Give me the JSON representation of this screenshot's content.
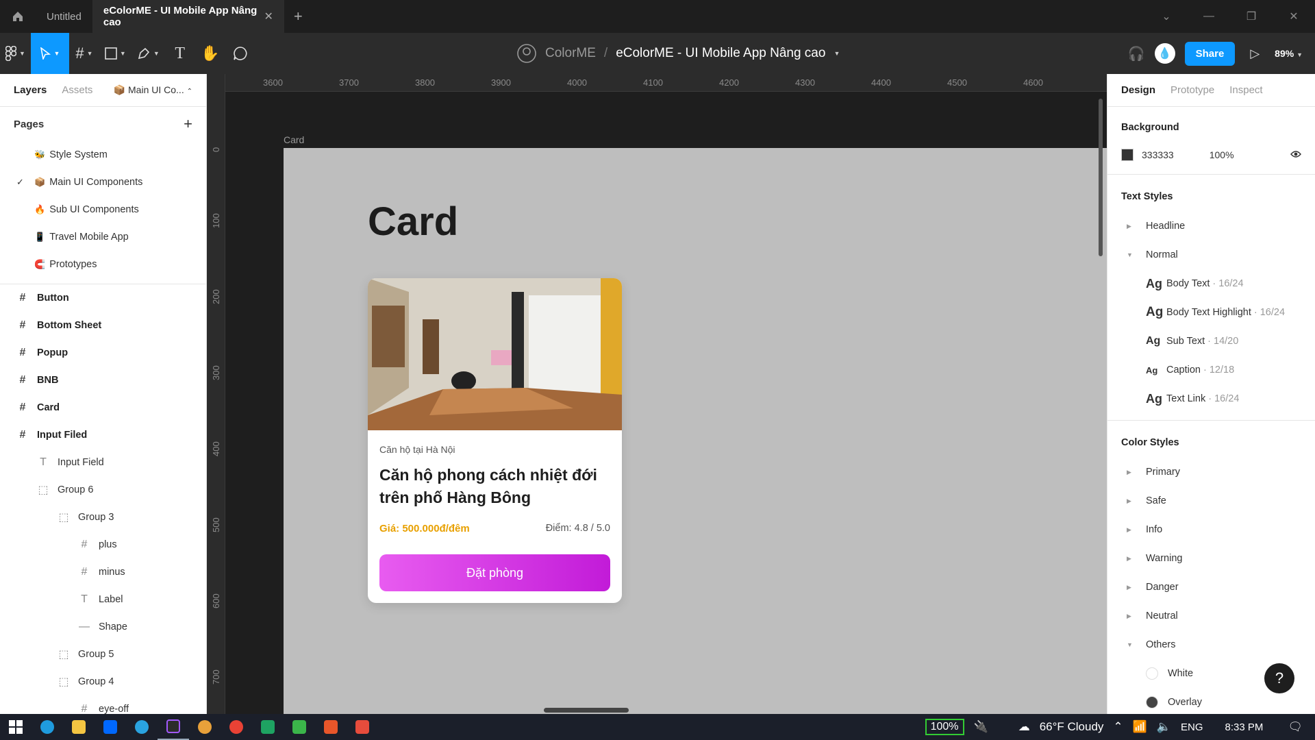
{
  "titlebar": {
    "tabs": [
      {
        "label": "Untitled"
      },
      {
        "label": "eColorME - UI Mobile App Nâng cao"
      }
    ]
  },
  "toolbar": {
    "team": "ColorME",
    "separator": "/",
    "file_name": "eColorME - UI Mobile App Nâng cao",
    "share_label": "Share",
    "zoom": "89%"
  },
  "left_panel": {
    "tabs": {
      "layers": "Layers",
      "assets": "Assets",
      "page": "Main UI Co..."
    },
    "pages_title": "Pages",
    "pages": [
      {
        "emoji": "🐝",
        "label": "Style System",
        "current": false
      },
      {
        "emoji": "📦",
        "label": "Main UI Components",
        "current": true
      },
      {
        "emoji": "🔥",
        "label": "Sub UI Components",
        "current": false
      },
      {
        "emoji": "📱",
        "label": "Travel Mobile App",
        "current": false
      },
      {
        "emoji": "🧲",
        "label": "Prototypes",
        "current": false
      }
    ],
    "layers": [
      {
        "icon": "#",
        "label": "Button",
        "indent": 0,
        "frame": true
      },
      {
        "icon": "#",
        "label": "Bottom Sheet",
        "indent": 0,
        "frame": true
      },
      {
        "icon": "#",
        "label": "Popup",
        "indent": 0,
        "frame": true
      },
      {
        "icon": "#",
        "label": "BNB",
        "indent": 0,
        "frame": true
      },
      {
        "icon": "#",
        "label": "Card",
        "indent": 0,
        "frame": true
      },
      {
        "icon": "#",
        "label": "Input Filed",
        "indent": 0,
        "frame": true
      },
      {
        "icon": "T",
        "label": "Input Field",
        "indent": 1,
        "frame": false
      },
      {
        "icon": "⬚",
        "label": "Group 6",
        "indent": 1,
        "frame": false
      },
      {
        "icon": "⬚",
        "label": "Group 3",
        "indent": 2,
        "frame": false
      },
      {
        "icon": "#",
        "label": "plus",
        "indent": 3,
        "frame": false
      },
      {
        "icon": "#",
        "label": "minus",
        "indent": 3,
        "frame": false
      },
      {
        "icon": "T",
        "label": "Label",
        "indent": 3,
        "frame": false
      },
      {
        "icon": "—",
        "label": "Shape",
        "indent": 3,
        "frame": false
      },
      {
        "icon": "⬚",
        "label": "Group 5",
        "indent": 2,
        "frame": false
      },
      {
        "icon": "⬚",
        "label": "Group 4",
        "indent": 2,
        "frame": false
      },
      {
        "icon": "#",
        "label": "eye-off",
        "indent": 3,
        "frame": false
      }
    ]
  },
  "rulers": {
    "top": [
      "3600",
      "3700",
      "3800",
      "3900",
      "4000",
      "4100",
      "4200",
      "4300",
      "4400",
      "4500",
      "4600"
    ],
    "left": [
      "0",
      "100",
      "200",
      "300",
      "400",
      "500",
      "600",
      "700"
    ]
  },
  "canvas": {
    "frame_label": "Card",
    "frame_title": "Card",
    "card": {
      "subtitle": "Căn hộ tại Hà Nội",
      "title": "Căn hộ phong cách nhiệt đới trên phố Hàng Bông",
      "price": "Giá: 500.000đ/đêm",
      "score": "Điểm: 4.8 / 5.0",
      "button": "Đặt phòng"
    }
  },
  "right_panel": {
    "tabs": {
      "design": "Design",
      "prototype": "Prototype",
      "inspect": "Inspect"
    },
    "background": {
      "title": "Background",
      "hex": "333333",
      "opacity": "100%"
    },
    "text_styles_title": "Text Styles",
    "text_groups": {
      "headline": "Headline",
      "normal": "Normal"
    },
    "text_styles": [
      {
        "name": "Body Text",
        "meta": "· 16/24"
      },
      {
        "name": "Body Text Highlight",
        "meta": "· 16/24"
      },
      {
        "name": "Sub Text",
        "meta": "· 14/20"
      },
      {
        "name": "Caption",
        "meta": "· 12/18"
      },
      {
        "name": "Text Link",
        "meta": "· 16/24"
      }
    ],
    "ag_label": "Ag",
    "color_styles_title": "Color Styles",
    "color_groups": [
      "Primary",
      "Safe",
      "Info",
      "Warning",
      "Danger",
      "Neutral",
      "Others"
    ],
    "color_items": [
      {
        "name": "White",
        "color": "#ffffff"
      },
      {
        "name": "Overlay",
        "color": "#444444"
      }
    ],
    "help": "?"
  },
  "taskbar": {
    "battery": "100%",
    "weather": "66°F Cloudy",
    "lang": "ENG",
    "time": "8:33 PM"
  },
  "colors": {
    "accent": "#0d99ff",
    "price": "#e8a000",
    "button_start": "#e85cf0",
    "button_end": "#c21bd8"
  }
}
